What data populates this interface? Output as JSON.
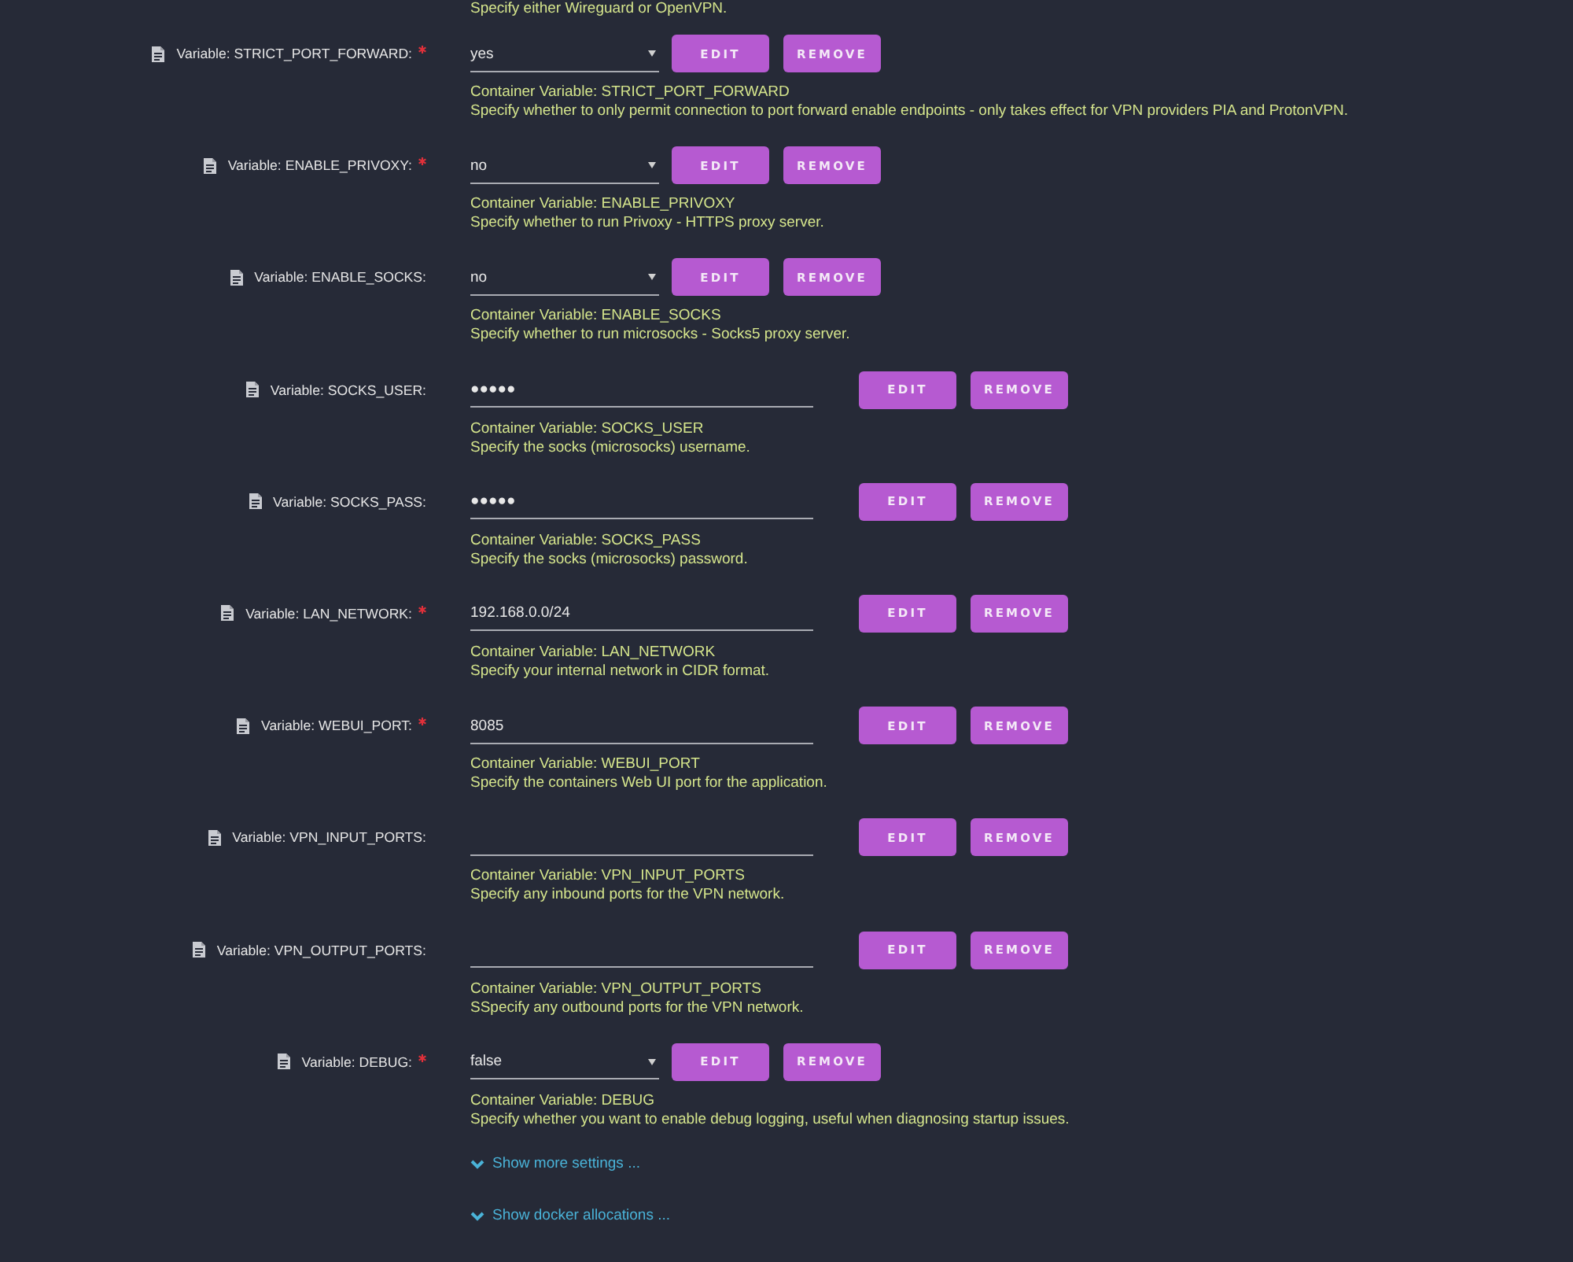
{
  "top_note": "Specify either Wireguard or OpenVPN.",
  "variables": [
    {
      "kind": "select",
      "label": "Variable: STRICT_PORT_FORWARD:",
      "required": true,
      "value": "yes",
      "buttons": [
        "EDIT",
        "REMOVE"
      ],
      "note": "Container Variable: STRICT_PORT_FORWARD",
      "description": "Specify whether to only permit connection to port forward enable endpoints - only takes effect for VPN providers PIA and ProtonVPN."
    },
    {
      "kind": "select",
      "label": "Variable: ENABLE_PRIVOXY:",
      "required": true,
      "value": "no",
      "buttons": [
        "EDIT",
        "REMOVE"
      ],
      "note": "Container Variable: ENABLE_PRIVOXY",
      "description": "Specify whether to run Privoxy - HTTPS proxy server."
    },
    {
      "kind": "select",
      "label": "Variable: ENABLE_SOCKS:",
      "required": false,
      "value": "no",
      "buttons": [
        "EDIT",
        "REMOVE"
      ],
      "note": "Container Variable: ENABLE_SOCKS",
      "description": "Specify whether to run microsocks - Socks5 proxy server."
    },
    {
      "kind": "text",
      "label": "Variable: SOCKS_USER:",
      "required": false,
      "value": "●●●●●",
      "buttons": [
        "EDIT",
        "REMOVE"
      ],
      "note": "Container Variable: SOCKS_USER",
      "description": "Specify the socks (microsocks) username."
    },
    {
      "kind": "text",
      "label": "Variable: SOCKS_PASS:",
      "required": false,
      "value": "●●●●●",
      "buttons": [
        "EDIT",
        "REMOVE"
      ],
      "note": "Container Variable: SOCKS_PASS",
      "description": "Specify the socks (microsocks) password."
    },
    {
      "kind": "text",
      "label": "Variable: LAN_NETWORK:",
      "required": true,
      "value": "192.168.0.0/24",
      "buttons": [
        "EDIT",
        "REMOVE"
      ],
      "note": "Container Variable: LAN_NETWORK",
      "description": "Specify your internal network in CIDR format."
    },
    {
      "kind": "text",
      "label": "Variable: WEBUI_PORT:",
      "required": true,
      "value": "8085",
      "buttons": [
        "EDIT",
        "REMOVE"
      ],
      "note": "Container Variable: WEBUI_PORT",
      "description": "Specify the containers Web UI port for the application."
    },
    {
      "kind": "text",
      "label": "Variable: VPN_INPUT_PORTS:",
      "required": false,
      "buttons": [
        "EDIT",
        "REMOVE"
      ],
      "note": "Container Variable: VPN_INPUT_PORTS",
      "description": "Specify any inbound ports for the VPN network."
    },
    {
      "kind": "text",
      "label": "Variable: VPN_OUTPUT_PORTS:",
      "required": false,
      "buttons": [
        "EDIT",
        "REMOVE"
      ],
      "note": "Container Variable: VPN_OUTPUT_PORTS",
      "description": "SSpecify any outbound ports for the VPN network."
    },
    {
      "kind": "select",
      "label": "Variable: DEBUG:",
      "required": true,
      "value": "false",
      "buttons": [
        "EDIT",
        "REMOVE"
      ],
      "note": "Container Variable: DEBUG",
      "description": "Specify whether you want to enable debug logging, useful when diagnosing startup issues."
    }
  ],
  "links": [
    {
      "label": "Show more settings ...",
      "expanded": false
    },
    {
      "label": "Show docker allocations ...",
      "expanded": false
    }
  ]
}
